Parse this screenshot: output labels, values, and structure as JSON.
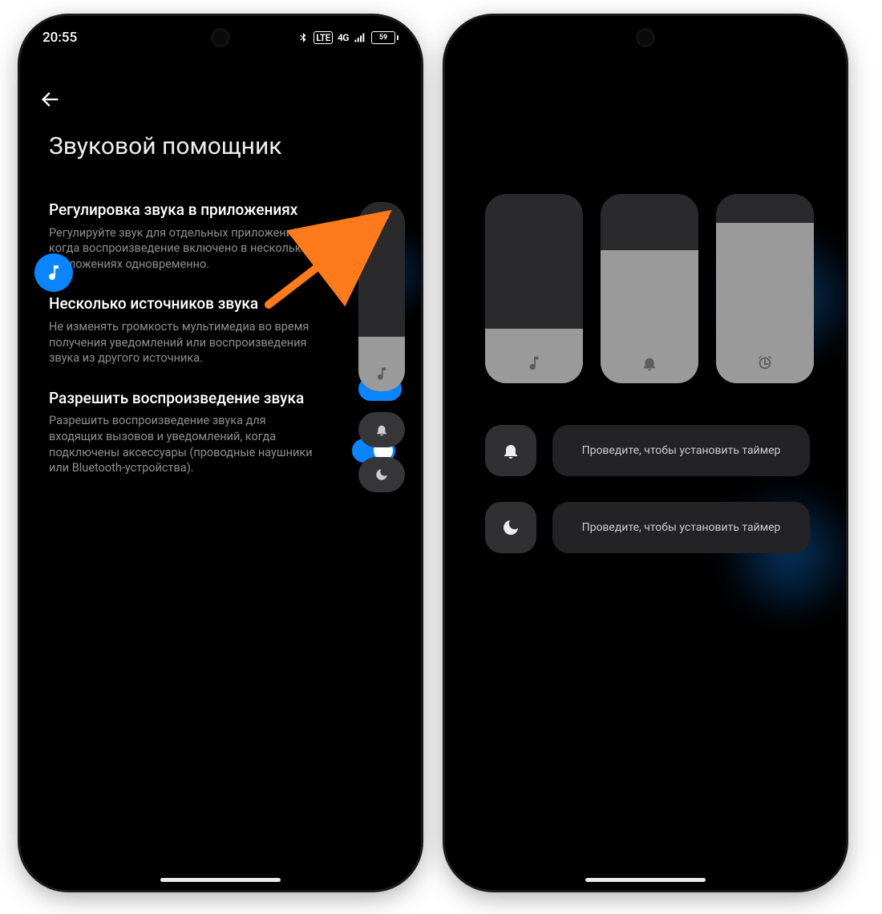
{
  "statusbar": {
    "time": "20:55",
    "network_label": "4G",
    "lte_badge": "LTE",
    "battery_pct": "59"
  },
  "left": {
    "title": "Звуковой помощник",
    "settings": [
      {
        "title": "Регулировка звука в приложениях",
        "desc": "Регулируйте звук для отдельных приложений, когда воспроизведение включено в нескольких приложениях одновременно."
      },
      {
        "title": "Несколько источников звука",
        "desc": "Не изменять громкость мультимедиа во время получения уведомлений или воспроизведения звука из другого источника."
      },
      {
        "title": "Разрешить воспроизведение звука",
        "desc": "Разрешить воспроизведение звука для входящих вызовов и уведомлений, когда подключены аксессуары (проводные наушники или Bluetooth-устройства)."
      }
    ]
  },
  "right": {
    "swipe_text": "Проведите, чтобы установить таймер"
  },
  "icons": {
    "music": "music-note",
    "bell": "bell",
    "moon": "moon",
    "alarm": "alarm-clock",
    "dots": "more-horizontal"
  },
  "sliders_fill_pct": {
    "media": 29,
    "ring": 70,
    "alarm": 85
  }
}
